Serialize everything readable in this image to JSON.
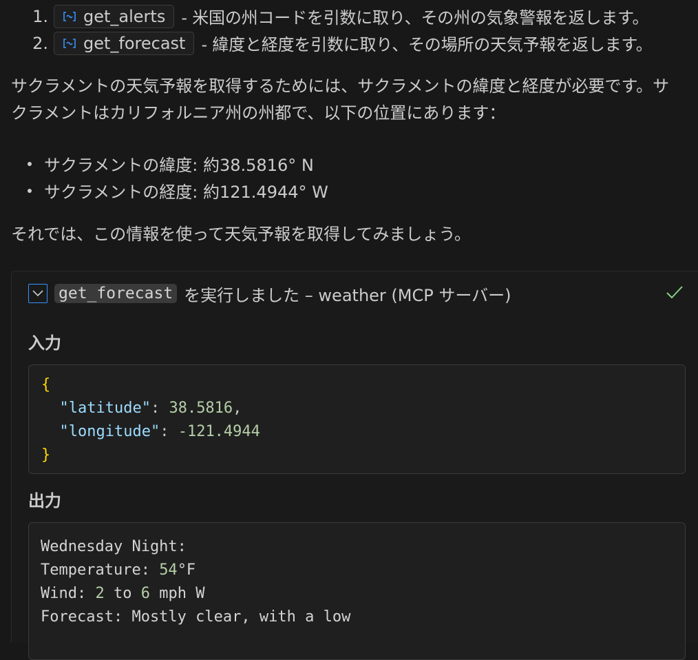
{
  "tools": [
    {
      "num": "1.",
      "name": "get_alerts",
      "desc": "- 米国の州コードを引数に取り、その州の気象警報を返します。"
    },
    {
      "num": "2.",
      "name": "get_forecast",
      "desc": "- 緯度と経度を引数に取り、その場所の天気予報を返します。"
    }
  ],
  "paragraph1": "サクラメントの天気予報を取得するためには、サクラメントの緯度と経度が必要です。サクラメントはカリフォルニア州の州都で、以下の位置にあります：",
  "bullets": [
    "サクラメントの緯度: 約38.5816° N",
    "サクラメントの経度: 約121.4944° W"
  ],
  "paragraph2": "それでは、この情報を使って天気予報を取得してみましょう。",
  "tool_run": {
    "tool_name": "get_forecast",
    "header_text": "を実行しました – weather (MCP サーバー)",
    "input_label": "入力",
    "output_label": "出力",
    "input": {
      "open_brace": "{",
      "close_brace": "}",
      "key1": "\"latitude\"",
      "val1": "38.5816",
      "key2": "\"longitude\"",
      "val2": "-121.4944"
    },
    "output": {
      "line1": "Wednesday Night:",
      "temp_label": "Temperature: ",
      "temp_value": "54",
      "temp_unit": "°F",
      "wind_label": "Wind: ",
      "wind_from": "2",
      "wind_to_word": " to ",
      "wind_to": "6",
      "wind_unit": " mph W",
      "forecast_line": "Forecast: Mostly clear, with a low"
    }
  },
  "colors": {
    "background": "#181818",
    "accent": "#3794ff",
    "success": "#89d185"
  },
  "icons": {
    "tool_chip": "tool-reference-icon",
    "toggle": "chevron-down-icon",
    "status": "check-icon"
  }
}
